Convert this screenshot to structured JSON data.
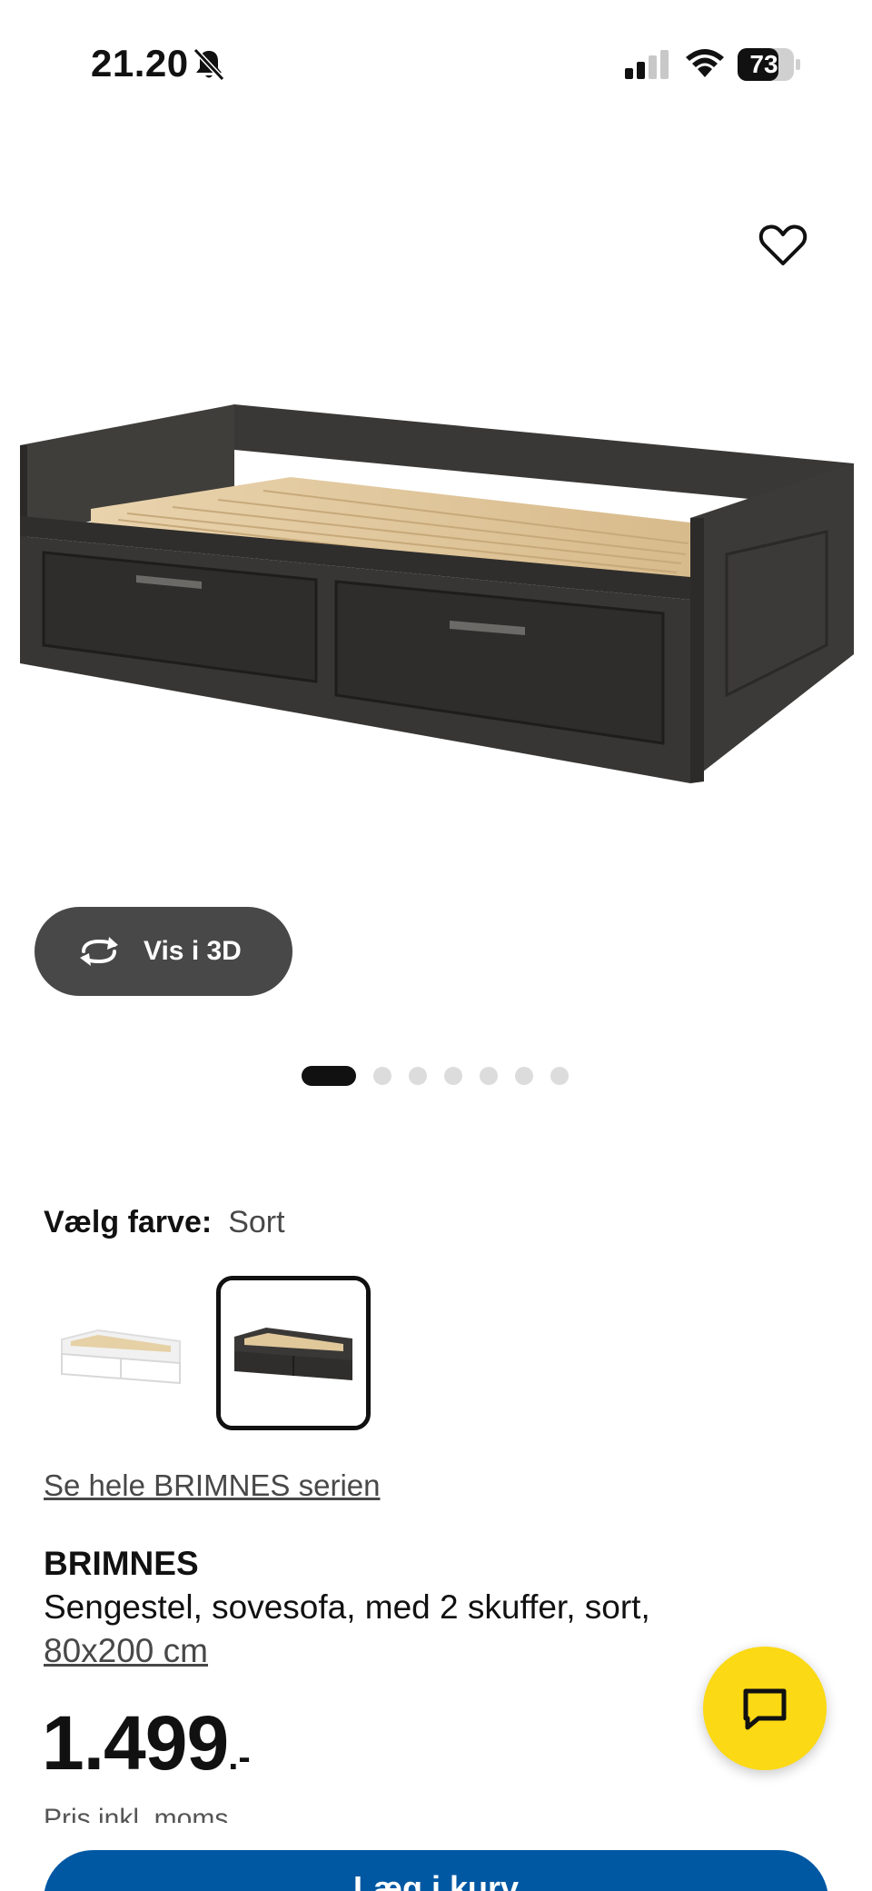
{
  "status_bar": {
    "time": "21.20",
    "battery": "73"
  },
  "product_gallery": {
    "view_3d_label": "Vis i 3D",
    "dots_count": 7,
    "active_dot_index": 0
  },
  "color_selector": {
    "label": "Vælg farve:",
    "selected_value": "Sort",
    "options": [
      "white",
      "black"
    ]
  },
  "series_link": "Se hele BRIMNES serien",
  "product": {
    "name": "BRIMNES",
    "description": "Sengestel, sovesofa, med 2 skuffer, sort,",
    "size": "80x200 cm",
    "price_main": "1.499",
    "price_suffix": ".-",
    "price_note": "Pris inkl. moms"
  },
  "cart_button_label": "Læg i kurv",
  "colors": {
    "brand_blue": "#0058a3",
    "chat_yellow": "#fbd914",
    "button_dark": "#484848"
  }
}
